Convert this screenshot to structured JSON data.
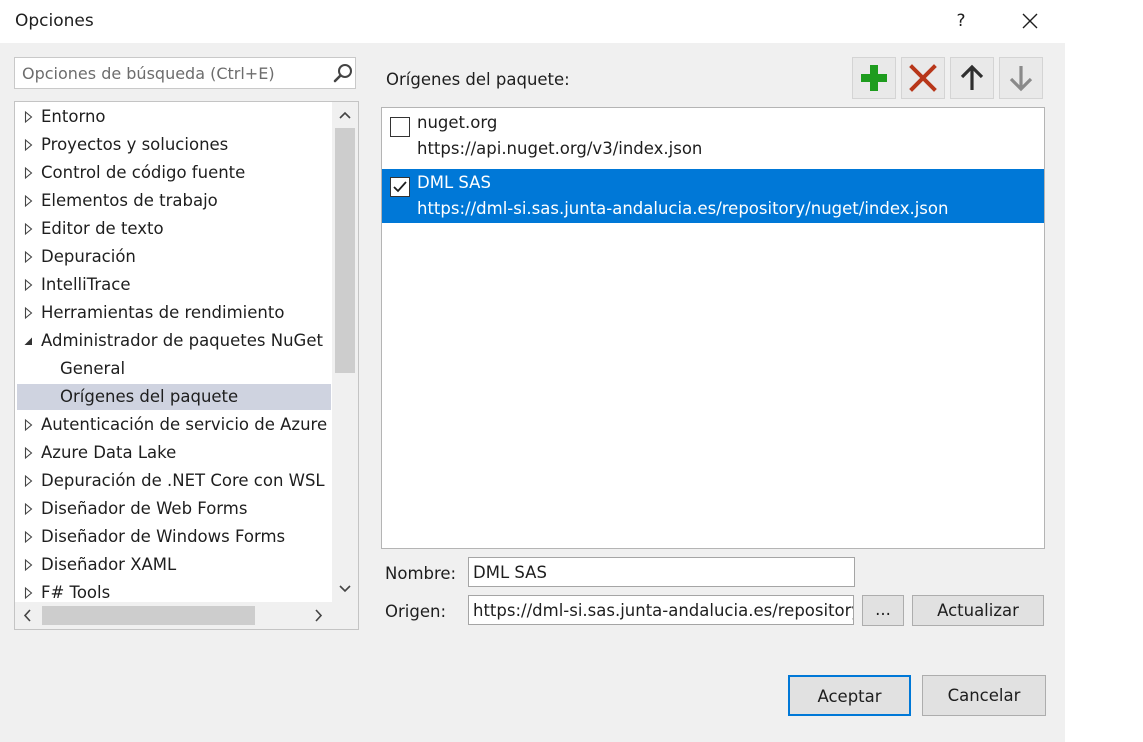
{
  "window": {
    "title": "Opciones",
    "help_label": "?"
  },
  "search": {
    "placeholder": "Opciones de búsqueda (Ctrl+E)"
  },
  "tree": {
    "items": [
      {
        "label": "Entorno",
        "state": "collapsed"
      },
      {
        "label": "Proyectos y soluciones",
        "state": "collapsed"
      },
      {
        "label": "Control de código fuente",
        "state": "collapsed"
      },
      {
        "label": "Elementos de trabajo",
        "state": "collapsed"
      },
      {
        "label": "Editor de texto",
        "state": "collapsed"
      },
      {
        "label": "Depuración",
        "state": "collapsed"
      },
      {
        "label": "IntelliTrace",
        "state": "collapsed"
      },
      {
        "label": "Herramientas de rendimiento",
        "state": "collapsed"
      },
      {
        "label": "Administrador de paquetes NuGet",
        "state": "expanded"
      },
      {
        "label": "General",
        "state": "child"
      },
      {
        "label": "Orígenes del paquete",
        "state": "child-selected"
      },
      {
        "label": "Autenticación de servicio de Azure",
        "state": "collapsed"
      },
      {
        "label": "Azure Data Lake",
        "state": "collapsed"
      },
      {
        "label": "Depuración de .NET Core con WSL",
        "state": "collapsed"
      },
      {
        "label": "Diseñador de Web Forms",
        "state": "collapsed"
      },
      {
        "label": "Diseñador de Windows Forms",
        "state": "collapsed"
      },
      {
        "label": "Diseñador XAML",
        "state": "collapsed"
      },
      {
        "label": "F# Tools",
        "state": "collapsed"
      }
    ]
  },
  "sources": {
    "heading": "Orígenes del paquete:",
    "list": [
      {
        "name": "nuget.org",
        "url": "https://api.nuget.org/v3/index.json",
        "checked": false,
        "selected": false
      },
      {
        "name": "DML SAS",
        "url": "https://dml-si.sas.junta-andalucia.es/repository/nuget/index.json",
        "checked": true,
        "selected": true
      }
    ],
    "toolbar_icons": [
      "add-icon",
      "remove-icon",
      "arrow-up-icon",
      "arrow-down-icon"
    ]
  },
  "form": {
    "name_label": "Nombre:",
    "name_value": "DML SAS",
    "origin_label": "Origen:",
    "origin_value": "https://dml-si.sas.junta-andalucia.es/repository/nuget/index.json",
    "browse_label": "...",
    "update_label": "Actualizar"
  },
  "buttons": {
    "ok_label": "Aceptar",
    "cancel_label": "Cancelar"
  },
  "colors": {
    "selection": "#0078d7",
    "tree_selection": "#cfd3e0",
    "add_green": "#1e9c1e",
    "remove_red": "#b8371a"
  }
}
